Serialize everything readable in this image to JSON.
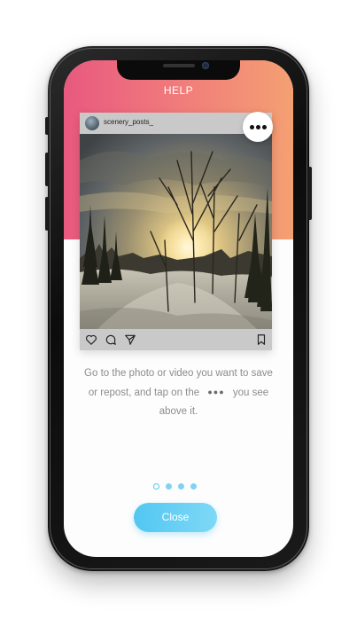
{
  "screen": {
    "title": "HELP"
  },
  "post": {
    "username": "scenery_posts_",
    "photo_icon": "winter-forest-sunset-photo",
    "more_icon": "more-options-icon",
    "actions": {
      "like_icon": "heart-icon",
      "comment_icon": "comment-icon",
      "share_icon": "send-icon",
      "save_icon": "bookmark-icon"
    }
  },
  "instructions": {
    "line1": "Go to the photo or video you want to save",
    "line2_before": "or repost, and tap on the",
    "dots": "●●●",
    "line2_after": "you see",
    "line3": "above it."
  },
  "pager": {
    "total": 4,
    "active_index": 0
  },
  "close_button": {
    "label": "Close"
  },
  "colors": {
    "header_gradient_start": "#e8597f",
    "header_gradient_end": "#f4a072",
    "close_button": "#52c7f2",
    "pager_active": "#52c7f2",
    "text": "#8c8c8c"
  }
}
